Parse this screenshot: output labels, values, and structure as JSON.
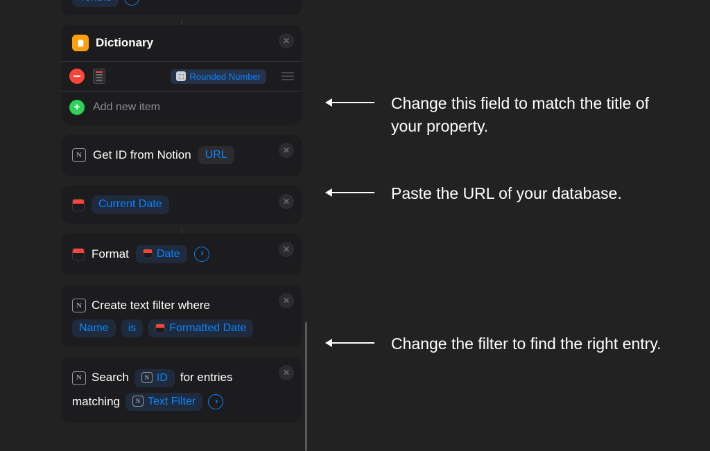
{
  "cards": {
    "tenths": {
      "pill": "Tenths"
    },
    "dictionary": {
      "title": "Dictionary",
      "value_chip": "Rounded Number",
      "add_label": "Add new item"
    },
    "get_id": {
      "prefix": "Get ID from Notion",
      "pill": "URL"
    },
    "current_date": {
      "pill": "Current Date"
    },
    "format": {
      "prefix": "Format",
      "pill": "Date"
    },
    "filter": {
      "prefix": "Create text filter where",
      "p1": "Name",
      "p2": "is",
      "p3": "Formatted Date"
    },
    "search": {
      "t1": "Search",
      "p1": "ID",
      "t2": "for entries matching",
      "p2": "Text Filter"
    }
  },
  "annotations": {
    "a1": "Change this field to match the title of your property.",
    "a2": "Paste the URL of your database.",
    "a3": "Change the filter to find the right entry."
  }
}
